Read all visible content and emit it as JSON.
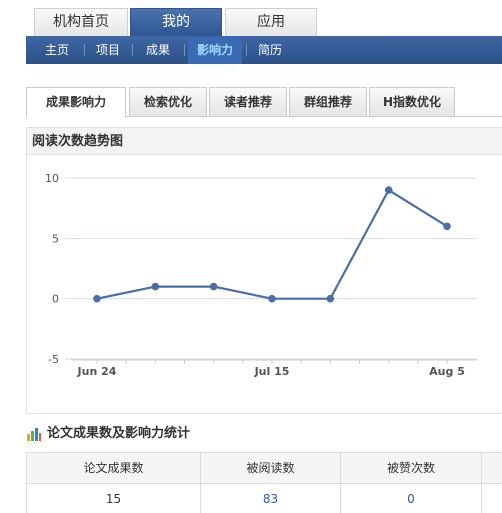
{
  "top_tabs": [
    "机构首页",
    "我的",
    "应用"
  ],
  "top_tab_active": 1,
  "subnav": {
    "items": [
      "主页",
      "项目",
      "成果",
      "影响力",
      "简历"
    ],
    "active": 3
  },
  "section_tabs": {
    "items": [
      "成果影响力",
      "检索优化",
      "读者推荐",
      "群组推荐",
      "H指数优化"
    ],
    "active": 0
  },
  "chart_panel": {
    "title": "阅读次数趋势图"
  },
  "chart_data": {
    "type": "line",
    "title": "阅读次数趋势图",
    "x": [
      0,
      7,
      14,
      21,
      28,
      35,
      42
    ],
    "values": [
      0,
      1,
      1,
      0,
      0,
      9,
      6
    ],
    "xticks": [
      {
        "label": "Jun 24",
        "at": 0
      },
      {
        "label": "Jul 15",
        "at": 21
      },
      {
        "label": "Aug 5",
        "at": 42
      }
    ],
    "xlabel": "",
    "ylabel": "",
    "yticks": [
      -5,
      0,
      5,
      10
    ],
    "ylim": [
      -5,
      10
    ],
    "grid": true,
    "colors": {
      "line": "#4a6ea7",
      "grid": "#d8dde6"
    }
  },
  "stats": {
    "title": "论文成果数及影响力统计",
    "headers": [
      "论文成果数",
      "被阅读数",
      "被赞次数"
    ],
    "values": [
      "15",
      "83",
      "0"
    ]
  },
  "colors": {
    "nav_blue": "#2f5690",
    "link_blue": "#2a5ca8",
    "active_subnav_text": "#9fd8ff"
  }
}
